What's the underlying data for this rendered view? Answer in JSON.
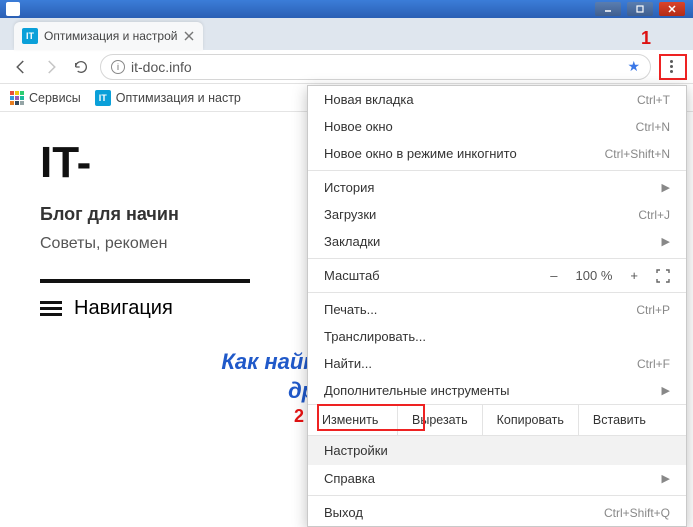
{
  "window_controls": {
    "min": "–",
    "max": "◻",
    "close": "✕"
  },
  "tab": {
    "favicon_text": "IT",
    "title": "Оптимизация и настрой"
  },
  "addr": {
    "url": "it-doc.info"
  },
  "bookmarks": {
    "apps": "Сервисы",
    "item1_favicon": "IT",
    "item1": "Оптимизация и настр"
  },
  "page": {
    "title": "IT-",
    "subtitle": "Блог для начин",
    "tagline": "Советы, рекомен",
    "nav": "Навигация",
    "article": "Как найти и установи\nдрайвера?"
  },
  "menu": {
    "new_tab": "Новая вкладка",
    "new_tab_sc": "Ctrl+T",
    "new_window": "Новое окно",
    "new_window_sc": "Ctrl+N",
    "incognito": "Новое окно в режиме инкогнито",
    "incognito_sc": "Ctrl+Shift+N",
    "history": "История",
    "downloads": "Загрузки",
    "downloads_sc": "Ctrl+J",
    "bookmarks": "Закладки",
    "zoom_label": "Масштаб",
    "zoom_minus": "–",
    "zoom_value": "100 %",
    "zoom_plus": "+",
    "print": "Печать...",
    "print_sc": "Ctrl+P",
    "cast": "Транслировать...",
    "find": "Найти...",
    "find_sc": "Ctrl+F",
    "tools": "Дополнительные инструменты",
    "edit_label": "Изменить",
    "cut": "Вырезать",
    "copy": "Копировать",
    "paste": "Вставить",
    "settings": "Настройки",
    "help": "Справка",
    "exit": "Выход",
    "exit_sc": "Ctrl+Shift+Q"
  },
  "annotations": {
    "one": "1",
    "two": "2"
  }
}
